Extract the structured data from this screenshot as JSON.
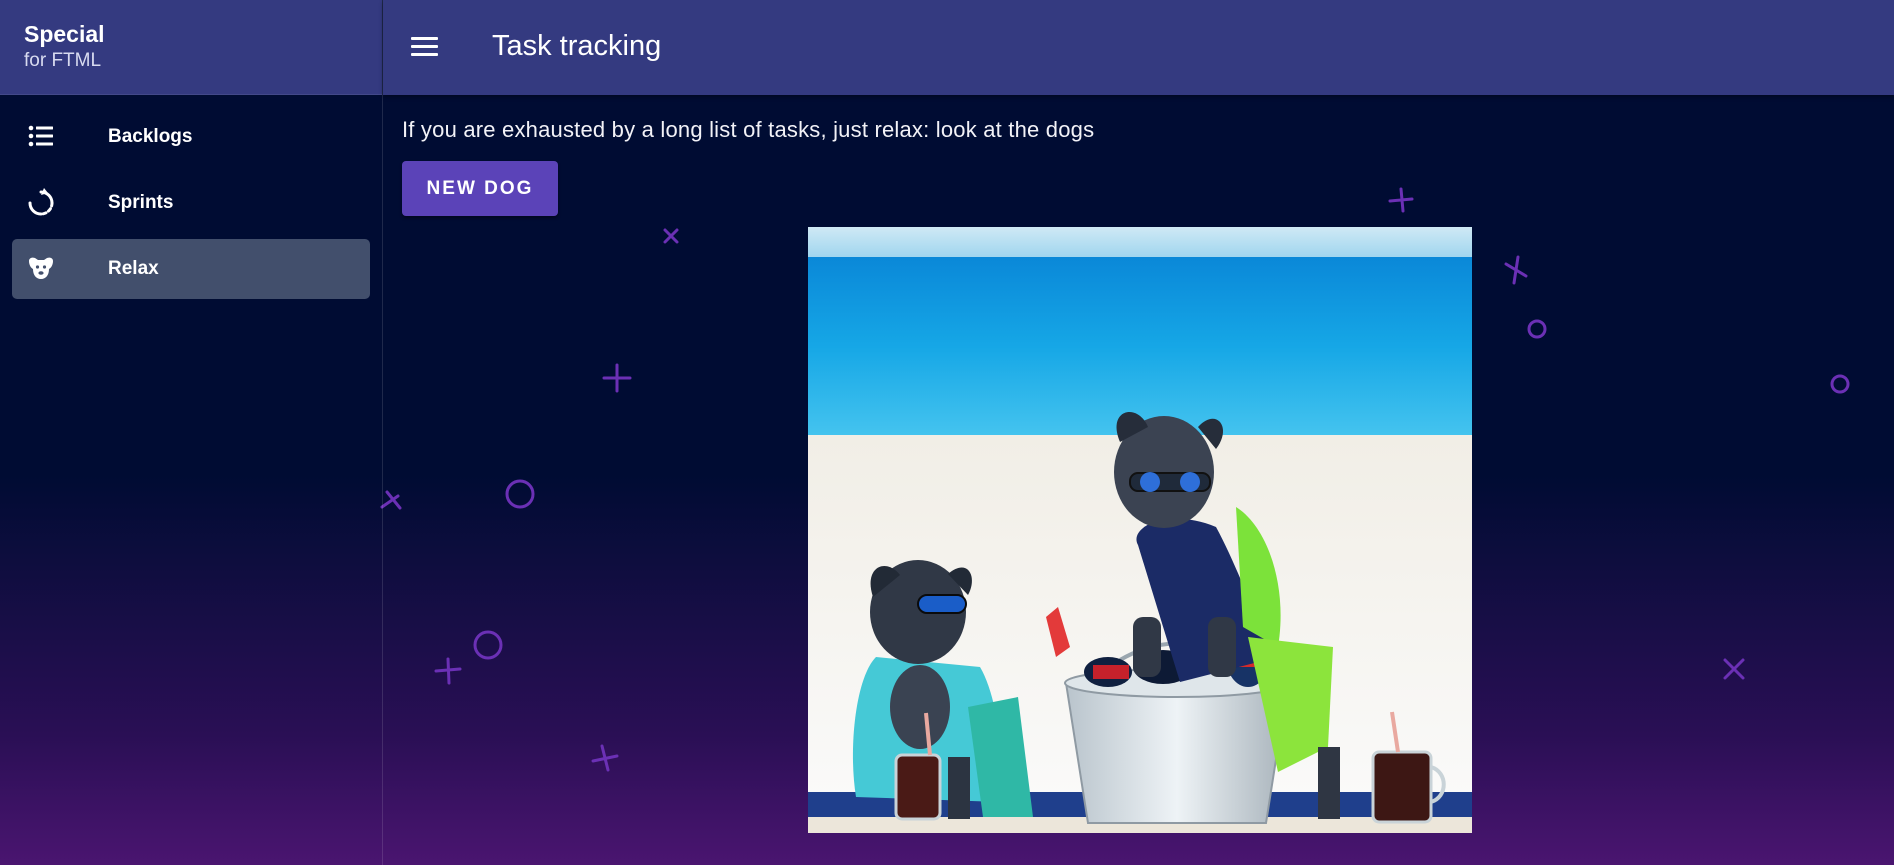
{
  "brand": {
    "title": "Special",
    "subtitle": "for FTML"
  },
  "nav": {
    "items": [
      {
        "label": "Backlogs",
        "icon": "list-icon"
      },
      {
        "label": "Sprints",
        "icon": "sprint-cycle-icon"
      },
      {
        "label": "Relax",
        "icon": "dog-icon",
        "active": true
      }
    ]
  },
  "header": {
    "title": "Task tracking",
    "menu_icon": "hamburger-menu-icon"
  },
  "main": {
    "intro": "If you are exhausted by a long list of tasks, just relax: look at the dogs",
    "new_dog_label": "NEW DOG",
    "photo_icon": "dog-photo"
  },
  "colors": {
    "header_bg": "#343a80",
    "page_bg": "#000c33",
    "active_nav_bg": "#424f6c",
    "button_bg": "#5b43b8",
    "decoration": "#6b2fb0"
  }
}
